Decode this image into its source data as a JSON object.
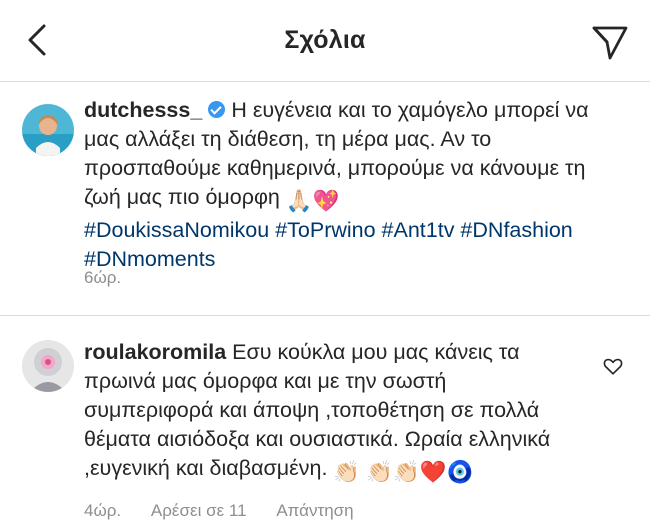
{
  "header": {
    "title": "Σχόλια",
    "back_icon": "chevron-left-icon",
    "send_icon": "paper-plane-icon"
  },
  "caption": {
    "username": "dutchesss_",
    "text": "Η ευγένεια και το χαμόγελο μπορεί να μας αλλάξει τη διάθεση, τη μέρα μας. Αν το προσπαθούμε καθημερινά, μπορούμε να κάνουμε τη ζωή  μας πιο όμορφη",
    "emojis": [
      "🙏🏻",
      "💖"
    ],
    "hashtags": "#DoukissaNomikou #ToPrwino #Ant1tv #DNfashion #DNmoments",
    "time": "6ώρ."
  },
  "comment": {
    "username": "roulakoromila",
    "text": "Εσυ κούκλα μου μας κάνεις τα πρωινά μας όμορφα και με την σωστή συμπεριφορά και άποψη ,τοποθέτηση σε πολλά θέματα αισιόδοξα και  ουσιαστικά. Ωραία ελληνικά ,ευγενική και διαβασμένη.",
    "emojis": [
      "👏🏻",
      "👏🏻",
      "👏🏻",
      "❤️",
      "🧿"
    ],
    "time": "4ώρ.",
    "likes": "Αρέσει σε 11",
    "reply": "Απάντηση"
  },
  "colors": {
    "hashtag": "#00376b",
    "verified": "#3897f0",
    "muted": "#8e8e8e"
  }
}
